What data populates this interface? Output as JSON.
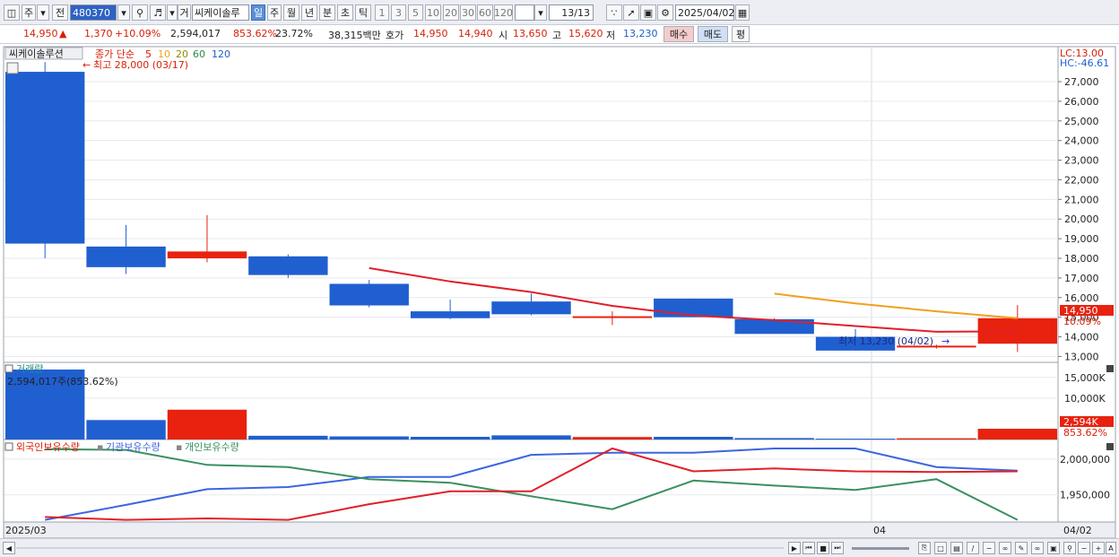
{
  "toolbar": {
    "market": "주",
    "prev_label": "전",
    "code": "480370",
    "trade_label": "거",
    "stock_name": "씨케이솔루",
    "periods": [
      "일",
      "주",
      "월",
      "년",
      "분",
      "초",
      "틱"
    ],
    "active_period": "일",
    "intervals": [
      "1",
      "3",
      "5",
      "10",
      "20",
      "30",
      "60",
      "120"
    ],
    "count": "13/13",
    "date": "2025/04/02"
  },
  "quote": {
    "price": "14,950",
    "change": "1,370",
    "change_pct": "+10.09%",
    "volume": "2,594,017",
    "vol_pct": "853.62%",
    "turnover_pct": "23.72%",
    "amount": "38,315백만",
    "ask_label": "호가",
    "ask": "14,950",
    "bid": "14,940",
    "open_label": "시",
    "open": "13,650",
    "high_label": "고",
    "high": "15,620",
    "low_label": "저",
    "low": "13,230",
    "buy_label": "매수",
    "sell_label": "매도",
    "extra_label": "평"
  },
  "price_panel": {
    "name_tab": "씨케이솔루션",
    "legend_prefix": "종가 단순",
    "ma_periods": [
      "5",
      "10",
      "20",
      "60",
      "120"
    ],
    "high_note": "최고 28,000 (03/17)",
    "low_note": "최저 13,230 (04/02)",
    "lc_label": "LC:13.00",
    "hc_label": "HC:-46.61",
    "y_ticks": [
      "27,000",
      "26,000",
      "25,000",
      "24,000",
      "23,000",
      "22,000",
      "21,000",
      "20,000",
      "19,000",
      "18,000",
      "17,000",
      "16,000",
      "15,000",
      "14,000",
      "13,000"
    ],
    "price_tag": "14,950",
    "pct_tag": "10.09%"
  },
  "volume_panel": {
    "title": "거래량",
    "readout": "2,594,017주(853.62%)",
    "y_ticks": [
      "15,000K",
      "10,000K"
    ],
    "vol_tag": "2,594K",
    "pct_tag": "853.62%"
  },
  "holding_panel": {
    "labels": [
      "외국인보유수량",
      "기관보유수량",
      "개인보유수량"
    ],
    "y_ticks": [
      "2,000,000",
      "1,950,000"
    ]
  },
  "x_axis": {
    "left_label": "2025/03",
    "mid_label": "04",
    "right_label": "04/02"
  },
  "colors": {
    "up": "#e8220f",
    "down": "#1f5fd0",
    "ma5": "#e0202a",
    "ma10": "#f0a020",
    "ma20": "#8c8c00",
    "ma60": "#2a8a4a",
    "ma120": "#2060c0",
    "foreign": "#e0202a",
    "institution": "#3a66e0",
    "individual": "#3a9060"
  },
  "chart_data": {
    "type": "candlestick",
    "candles": [
      {
        "o": 27500,
        "h": 28000,
        "l": 18000,
        "c": 18750
      },
      {
        "o": 18600,
        "h": 19700,
        "l": 17200,
        "c": 17550
      },
      {
        "o": 18000,
        "h": 20200,
        "l": 17800,
        "c": 18350
      },
      {
        "o": 18100,
        "h": 18200,
        "l": 17000,
        "c": 17150
      },
      {
        "o": 16700,
        "h": 16900,
        "l": 15500,
        "c": 15600
      },
      {
        "o": 15300,
        "h": 15900,
        "l": 14900,
        "c": 14950
      },
      {
        "o": 15800,
        "h": 16200,
        "l": 15100,
        "c": 15150
      },
      {
        "o": 15050,
        "h": 15300,
        "l": 14600,
        "c": 15050
      },
      {
        "o": 15950,
        "h": 15950,
        "l": 15000,
        "c": 15000
      },
      {
        "o": 14900,
        "h": 14950,
        "l": 14150,
        "c": 14150
      },
      {
        "o": 14000,
        "h": 14400,
        "l": 13300,
        "c": 13300
      },
      {
        "o": 13550,
        "h": 13600,
        "l": 13400,
        "c": 13550
      },
      {
        "o": 13650,
        "h": 15620,
        "l": 13230,
        "c": 14950
      }
    ],
    "ma5": [
      null,
      null,
      null,
      null,
      17500,
      16820,
      16280,
      15580,
      15090,
      14850,
      14550,
      14260,
      14280
    ],
    "ma10": [
      null,
      null,
      null,
      null,
      null,
      null,
      null,
      null,
      null,
      16200,
      15700,
      15300,
      14950
    ],
    "volume_k": [
      16900,
      4700,
      7200,
      900,
      750,
      650,
      1000,
      600,
      650,
      350,
      200,
      300,
      2594
    ],
    "foreign": [
      1919000,
      1915000,
      1917000,
      1915000,
      1937000,
      1955000,
      1955000,
      2015000,
      1983000,
      1987000,
      1983000,
      1982000,
      1983000
    ],
    "institution": [
      1915000,
      1936000,
      1958000,
      1961000,
      1975000,
      1975000,
      2006000,
      2009000,
      2009000,
      2015000,
      2015000,
      1989000,
      1984000
    ],
    "individual": [
      2014000,
      2013000,
      1992000,
      1989000,
      1972000,
      1967000,
      1948000,
      1930000,
      1970000,
      1963000,
      1957000,
      1972000,
      1915000
    ],
    "price_ylim": [
      12700,
      28600
    ],
    "volume_ylim": [
      0,
      18200
    ],
    "holding_ylim": [
      1912000,
      2020000
    ]
  }
}
